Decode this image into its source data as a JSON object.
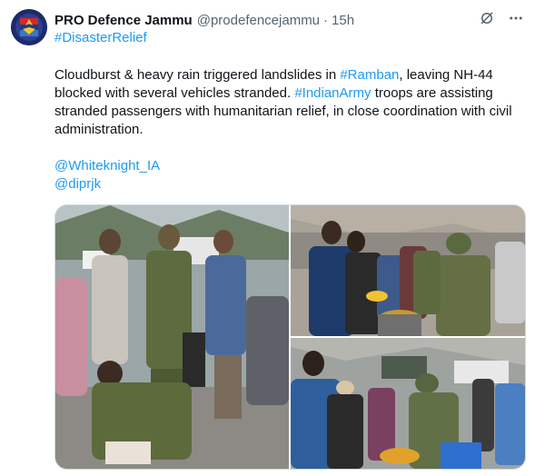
{
  "tweet": {
    "display_name": "PRO Defence Jammu",
    "handle": "@prodefencejammu",
    "separator": "·",
    "time": "15h",
    "top_hashtag": "#DisasterRelief",
    "body": {
      "seg1": "Cloudburst & heavy rain triggered landslides in ",
      "link1": "#Ramban",
      "seg2": ", leaving NH-44 blocked with several vehicles stranded. ",
      "link2": "#IndianArmy",
      "seg3": " troops are assisting stranded passengers with humanitarian relief, in close coordination with civil administration."
    },
    "mentions": [
      "@Whiteknight_IA",
      "@diprjk"
    ]
  },
  "icons": {
    "grok": "grok-icon",
    "more": "more-icon"
  },
  "colors": {
    "link": "#1d9bf0",
    "text": "#0f1419",
    "muted": "#536471",
    "border": "#cfd9de"
  }
}
